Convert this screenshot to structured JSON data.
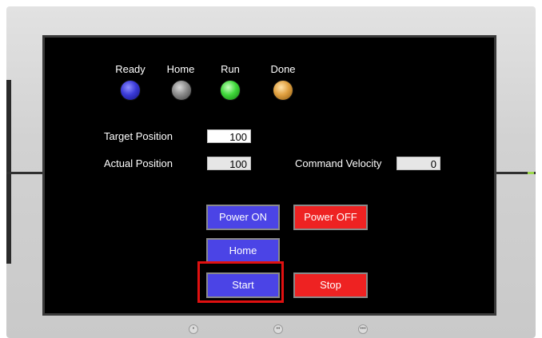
{
  "indicators": [
    {
      "label": "Ready",
      "color": "#3a3ad8"
    },
    {
      "label": "Home",
      "color": "#8a8a8a"
    },
    {
      "label": "Run",
      "color": "#3fd83a"
    },
    {
      "label": "Done",
      "color": "#e0a040"
    }
  ],
  "fields": {
    "target_position": {
      "label": "Target Position",
      "value": "100"
    },
    "actual_position": {
      "label": "Actual Position",
      "value": "100"
    },
    "command_velocity": {
      "label": "Command Velocity",
      "value": "0"
    }
  },
  "buttons": {
    "power_on": "Power ON",
    "power_off": "Power OFF",
    "home": "Home",
    "start": "Start",
    "stop": "Stop"
  },
  "colors": {
    "button_blue": "#4b44e6",
    "button_red": "#ee2222",
    "highlight": "#e01010",
    "screen": "#000000"
  }
}
